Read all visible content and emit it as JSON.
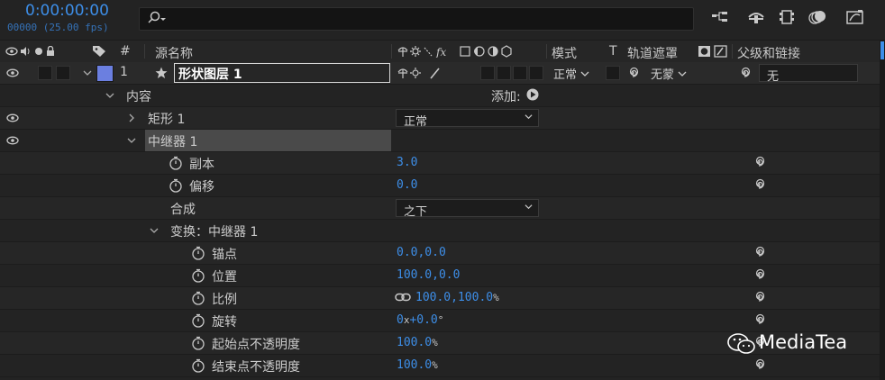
{
  "header_bar": {
    "timecode": "0:00:00:00",
    "fps": "00000 (25.00 fps)",
    "search_icon": "search-icon",
    "toolbar_icons": [
      "composition-flowchart-icon",
      "draft-3d-icon",
      "frame-blending-icon",
      "motion-blur-icon",
      "graph-editor-icon"
    ]
  },
  "columns": {
    "index": "#",
    "source_name": "源名称",
    "mode": "模式",
    "t": "T",
    "track_matte": "轨道遮罩",
    "parent": "父级和链接"
  },
  "layer": {
    "index": "1",
    "name": "形状图层 1",
    "label_color": "#6b7fe0",
    "mode": "正常",
    "track_matte": "无蒙",
    "parent": "无"
  },
  "tree": {
    "contents_label": "内容",
    "add_label": "添加:",
    "rectangle": {
      "label": "矩形 1",
      "mode": "正常"
    },
    "repeater": {
      "label": "中继器 1",
      "copies": {
        "label": "副本",
        "value": "3.0"
      },
      "offset": {
        "label": "偏移",
        "value": "0.0"
      },
      "composite": {
        "label": "合成",
        "value": "之下"
      },
      "transform": {
        "label": "变换：中继器 1",
        "anchor": {
          "label": "锚点",
          "value": "0.0,0.0"
        },
        "position": {
          "label": "位置",
          "value": "100.0,0.0"
        },
        "scale": {
          "label": "比例",
          "value": "100.0,100.0",
          "unit": "%"
        },
        "rotation": {
          "label": "旋转",
          "value_x": "0",
          "x": "x",
          "value": "+0.0",
          "unit": "°"
        },
        "start_opacity": {
          "label": "起始点不透明度",
          "value": "100.0",
          "unit": "%"
        },
        "end_opacity": {
          "label": "结束点不透明度",
          "value": "100.0",
          "unit": "%"
        }
      }
    }
  },
  "watermark": "MediaTea",
  "colors": {
    "accent": "#3d8ee8",
    "background": "#232323"
  }
}
